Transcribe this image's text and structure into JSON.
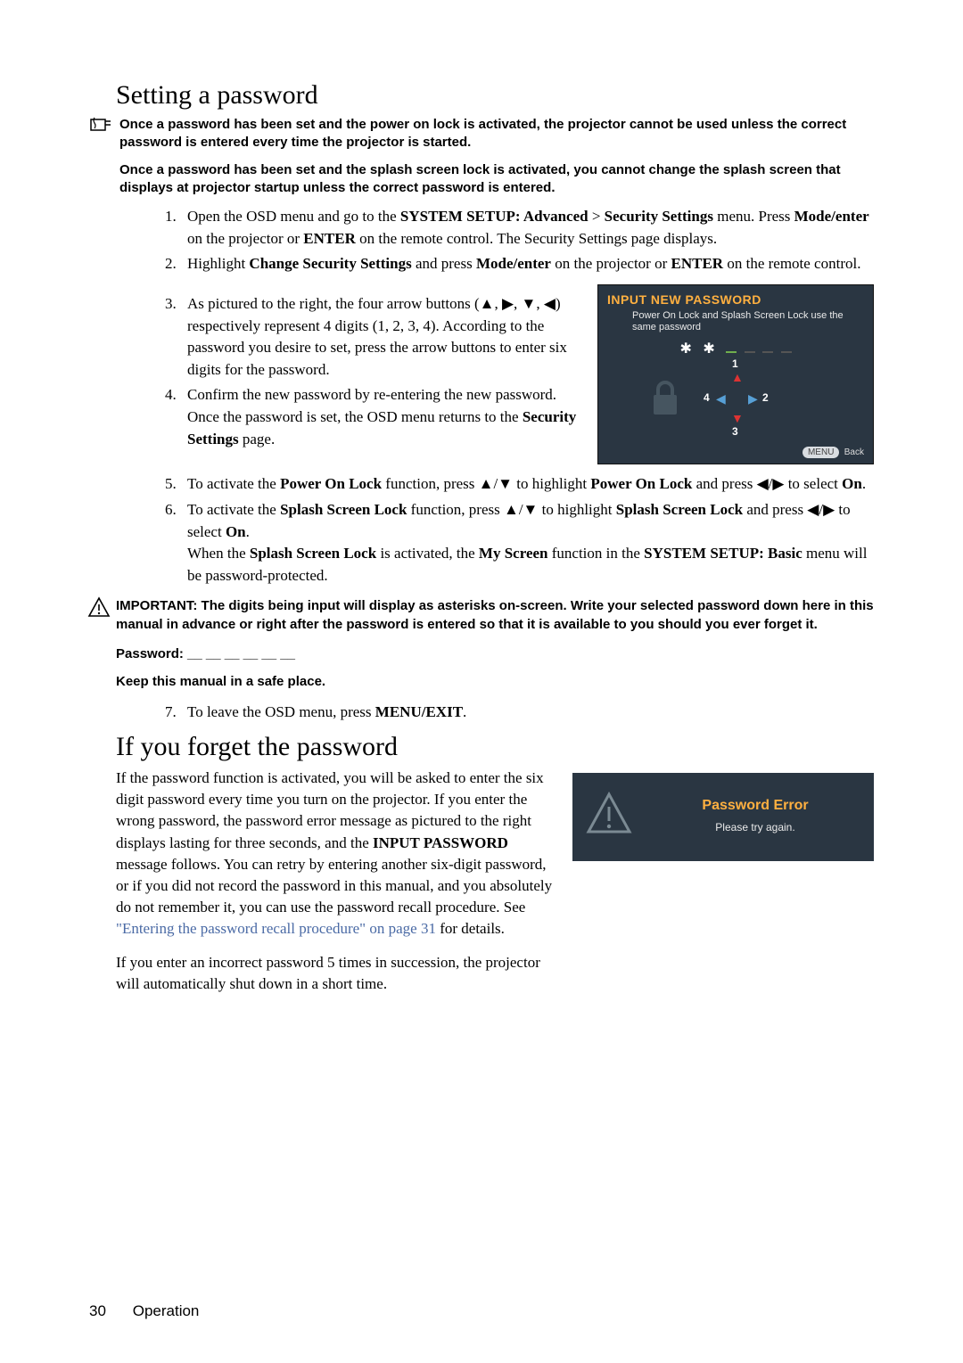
{
  "heading1": "Setting a password",
  "note1": "Once a password has been set and the power on lock is activated, the projector cannot be used unless the correct password is entered every time the projector is started.",
  "note2": "Once a password has been set and the splash screen lock is activated, you cannot change the splash screen that displays at projector startup unless the correct password is entered.",
  "steps": {
    "s1a": "Open the OSD menu and go to the ",
    "s1b": "SYSTEM SETUP: Advanced",
    "s1c": " > ",
    "s1d": "Security Settings",
    "s1e": " menu. Press ",
    "s1f": "Mode/enter",
    "s1g": " on the projector or ",
    "s1h": "ENTER",
    "s1i": " on the remote control. The Security Settings page displays.",
    "s2a": "Highlight ",
    "s2b": "Change Security Settings",
    "s2c": " and press ",
    "s2d": "Mode/enter",
    "s2e": " on the projector or ",
    "s2f": "ENTER",
    "s2g": " on the remote control.",
    "s3": "As pictured to the right, the four arrow buttons (▲, ▶, ▼, ◀) respectively represent 4 digits (1, 2, 3, 4). According to the password you desire to set, press the arrow buttons to enter six digits for the password.",
    "s4a": "Confirm the new password by re-entering the new password.",
    "s4b": "Once the password is set, the OSD menu returns to the ",
    "s4c": "Security Settings",
    "s4d": " page.",
    "s5a": "To activate the ",
    "s5b": "Power On Lock",
    "s5c": " function, press ▲/▼ to highlight ",
    "s5d": "Power On Lock",
    "s5e": " and press ◀/▶ to select ",
    "s5f": "On",
    "s5g": ".",
    "s6a": "To activate the ",
    "s6b": "Splash Screen Lock",
    "s6c": " function, press ▲/▼ to highlight ",
    "s6d": "Splash Screen Lock",
    "s6e": " and press ◀/▶ to select ",
    "s6f": "On",
    "s6g": ".",
    "s6h": "When the ",
    "s6i": "Splash Screen Lock",
    "s6j": " is activated, the ",
    "s6k": "My Screen",
    "s6l": " function in the ",
    "s6m": "SYSTEM SETUP: Basic",
    "s6n": " menu will be password-protected.",
    "s7a": "To leave the OSD menu, press ",
    "s7b": "MENU/EXIT",
    "s7c": "."
  },
  "caution": "IMPORTANT: The digits being input will display as asterisks on-screen. Write your selected password down here in this manual in advance or right after the password is entered so that it is available to you should you ever forget it.",
  "pw_line": "Password: __ __ __ __ __ __",
  "keep_line": "Keep this manual in a safe place.",
  "osd": {
    "title": "INPUT NEW PASSWORD",
    "sub": "Power On Lock and Splash Screen Lock use the same password",
    "n1": "1",
    "n2": "2",
    "n3": "3",
    "n4": "4",
    "menu": "MENU",
    "back": "Back"
  },
  "heading2": "If you forget the password",
  "forget_p1a": "If the password function is activated, you will be asked to enter the six digit password every time you turn on the projector. If you enter the wrong password, the password error message as pictured to the right displays lasting for three seconds, and the ",
  "forget_p1b": "INPUT PASSWORD",
  "forget_p1c": " message follows. You can retry by entering another six-digit password, or if you did not record the password in this manual, and you absolutely do not remember it, you can use the password recall procedure. See ",
  "forget_link": "\"Entering the password recall procedure\" on page 31",
  "forget_p1d": " for details.",
  "forget_p2": "If you enter an incorrect password 5 times in succession, the projector will automatically shut down in a short time.",
  "err": {
    "title": "Password Error",
    "sub": "Please try again."
  },
  "footer": {
    "page": "30",
    "section": "Operation"
  }
}
